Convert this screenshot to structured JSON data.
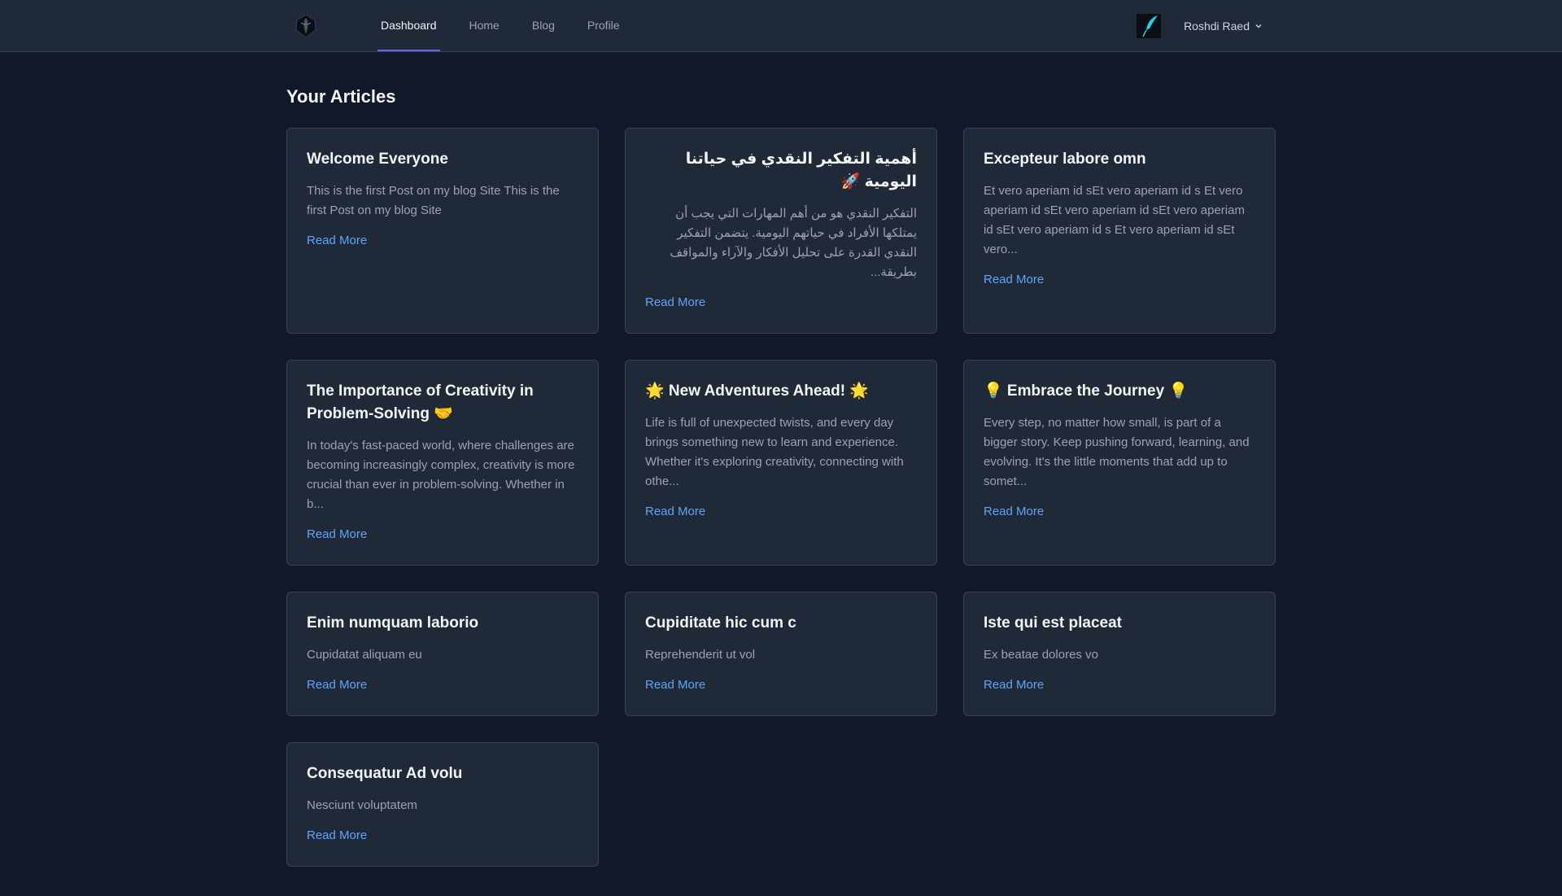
{
  "nav": {
    "items": [
      {
        "label": "Dashboard",
        "active": true
      },
      {
        "label": "Home",
        "active": false
      },
      {
        "label": "Blog",
        "active": false
      },
      {
        "label": "Profile",
        "active": false
      }
    ],
    "user_name": "Roshdi Raed",
    "logo_icon": "logo-icon",
    "avatar_icon": "feather-avatar"
  },
  "page": {
    "title": "Your Articles"
  },
  "articles": [
    {
      "title": "Welcome Everyone",
      "excerpt": "This is the first Post on my blog Site This is the first Post on my blog Site",
      "link": "Read More",
      "rtl": false
    },
    {
      "title": "أهمية التفكير النقدي في حياتنا اليومية 🚀",
      "excerpt": "التفكير النقدي هو من أهم المهارات التي يجب أن يمتلكها الأفراد في حياتهم اليومية. يتضمن التفكير النقدي القدرة على تحليل الأفكار والآراء والمواقف بطريقة...",
      "link": "Read More",
      "rtl": true
    },
    {
      "title": "Excepteur labore omn",
      "excerpt": "Et vero aperiam id sEt vero aperiam id s Et vero aperiam id sEt vero aperiam id sEt vero aperiam id sEt vero aperiam id s Et vero aperiam id sEt vero...",
      "link": "Read More",
      "rtl": false
    },
    {
      "title": "The Importance of Creativity in Problem-Solving 🤝",
      "excerpt": "In today's fast-paced world, where challenges are becoming increasingly complex, creativity is more crucial than ever in problem-solving. Whether in b...",
      "link": "Read More",
      "rtl": false
    },
    {
      "title": "🌟 New Adventures Ahead! 🌟",
      "excerpt": "Life is full of unexpected twists, and every day brings something new to learn and experience. Whether it's exploring creativity, connecting with othe...",
      "link": "Read More",
      "rtl": false
    },
    {
      "title": "💡 Embrace the Journey 💡",
      "excerpt": "Every step, no matter how small, is part of a bigger story. Keep pushing forward, learning, and evolving. It's the little moments that add up to somet...",
      "link": "Read More",
      "rtl": false
    },
    {
      "title": "Enim numquam laborio",
      "excerpt": "Cupidatat aliquam eu",
      "link": "Read More",
      "rtl": false
    },
    {
      "title": "Cupiditate hic cum c",
      "excerpt": "Reprehenderit ut vol",
      "link": "Read More",
      "rtl": false
    },
    {
      "title": "Iste qui est placeat",
      "excerpt": "Ex beatae dolores vo",
      "link": "Read More",
      "rtl": false
    },
    {
      "title": "Consequatur Ad volu",
      "excerpt": "Nesciunt voluptatem",
      "link": "Read More",
      "rtl": false
    }
  ],
  "colors": {
    "background": "#111827",
    "card": "#1f2937",
    "border": "#374151",
    "accent_link": "#60a5fa",
    "active_tab_underline": "#6366f1"
  }
}
